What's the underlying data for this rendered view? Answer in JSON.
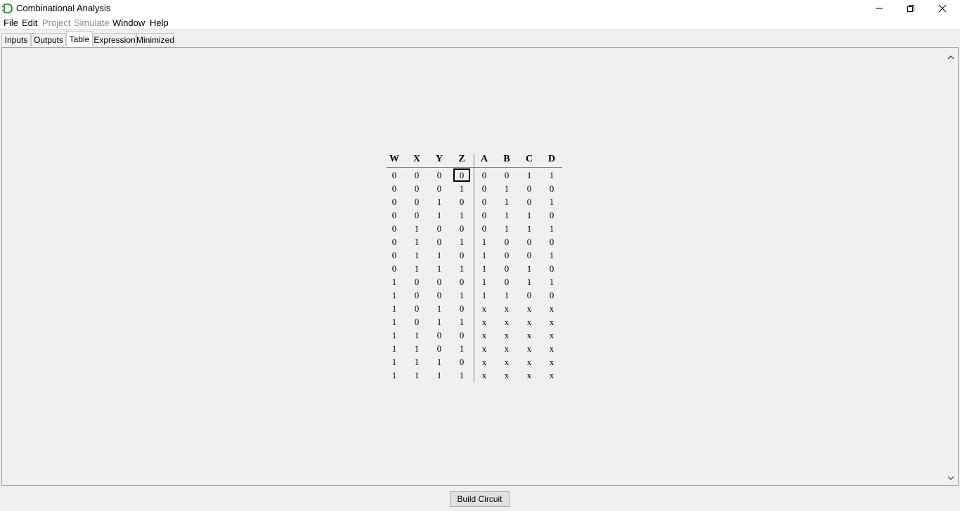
{
  "window": {
    "title": "Combinational Analysis"
  },
  "menu": [
    {
      "label": "File",
      "enabled": true
    },
    {
      "label": "Edit",
      "enabled": true
    },
    {
      "label": "Project",
      "enabled": false
    },
    {
      "label": "Simulate",
      "enabled": false
    },
    {
      "label": "Window",
      "enabled": true
    },
    {
      "label": "Help",
      "enabled": true
    }
  ],
  "tabs": [
    {
      "label": "Inputs",
      "active": false
    },
    {
      "label": "Outputs",
      "active": false
    },
    {
      "label": "Table",
      "active": true
    },
    {
      "label": "Expression",
      "active": false
    },
    {
      "label": "Minimized",
      "active": false
    }
  ],
  "table": {
    "inputs": [
      "W",
      "X",
      "Y",
      "Z"
    ],
    "outputs": [
      "A",
      "B",
      "C",
      "D"
    ],
    "rows": [
      [
        "0",
        "0",
        "0",
        "0",
        "0",
        "0",
        "1",
        "1"
      ],
      [
        "0",
        "0",
        "0",
        "1",
        "0",
        "1",
        "0",
        "0"
      ],
      [
        "0",
        "0",
        "1",
        "0",
        "0",
        "1",
        "0",
        "1"
      ],
      [
        "0",
        "0",
        "1",
        "1",
        "0",
        "1",
        "1",
        "0"
      ],
      [
        "0",
        "1",
        "0",
        "0",
        "0",
        "1",
        "1",
        "1"
      ],
      [
        "0",
        "1",
        "0",
        "1",
        "1",
        "0",
        "0",
        "0"
      ],
      [
        "0",
        "1",
        "1",
        "0",
        "1",
        "0",
        "0",
        "1"
      ],
      [
        "0",
        "1",
        "1",
        "1",
        "1",
        "0",
        "1",
        "0"
      ],
      [
        "1",
        "0",
        "0",
        "0",
        "1",
        "0",
        "1",
        "1"
      ],
      [
        "1",
        "0",
        "0",
        "1",
        "1",
        "1",
        "0",
        "0"
      ],
      [
        "1",
        "0",
        "1",
        "0",
        "x",
        "x",
        "x",
        "x"
      ],
      [
        "1",
        "0",
        "1",
        "1",
        "x",
        "x",
        "x",
        "x"
      ],
      [
        "1",
        "1",
        "0",
        "0",
        "x",
        "x",
        "x",
        "x"
      ],
      [
        "1",
        "1",
        "0",
        "1",
        "x",
        "x",
        "x",
        "x"
      ],
      [
        "1",
        "1",
        "1",
        "0",
        "x",
        "x",
        "x",
        "x"
      ],
      [
        "1",
        "1",
        "1",
        "1",
        "x",
        "x",
        "x",
        "x"
      ]
    ]
  },
  "buttons": {
    "build": "Build Circuit"
  }
}
